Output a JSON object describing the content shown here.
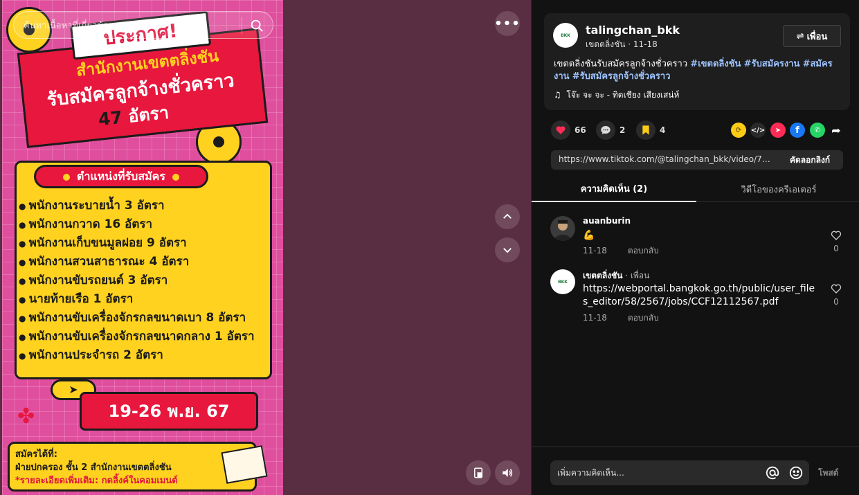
{
  "search": {
    "placeholder": "ค้นหาเนื้อหาที่เกี่ยวข้อง"
  },
  "poster": {
    "announce": "ประกาศ!",
    "line1": "สำนักงานเขตตลิ่งชัน",
    "line2": "รับสมัครลูกจ้างชั่วคราว",
    "count": "47",
    "count_unit": "อัตรา",
    "positions_header": "ตำแหน่งที่รับสมัคร",
    "positions": [
      "พนักงานระบายน้ำ 3 อัตรา",
      "พนักงานกวาด 16 อัตรา",
      "พนักงานเก็บขนมูลฝอย 9 อัตรา",
      "พนักงานสวนสาธารณะ 4 อัตรา",
      "พนักงานขับรถยนต์ 3 อัตรา",
      "นายท้ายเรือ 1 อัตรา",
      "พนักงานขับเครื่องจักรกลขนาดเบา 8 อัตรา",
      "พนักงานขับเครื่องจักรกลขนาดกลาง 1 อัตรา",
      "พนักงานประจำรถ 2 อัตรา"
    ],
    "date": "19-26 พ.ย. 67",
    "apply_title": "สมัครได้ที่:",
    "apply_place": "ฝ่ายปกครอง ชั้น 2 สำนักงานเขตตลิ่งชัน",
    "apply_note": "*รายละเอียดเพิ่มเติม: กดลิ้งค์ในคอมเมนต์"
  },
  "post": {
    "username": "talingchan_bkk",
    "subtitle": "เขตตลิ่งชัน · 11-18",
    "follow_label": "เพื่อน",
    "desc_text": "เขตตลิ่งชันรับสมัครลูกจ้างชั่วคราว ",
    "hashtags": [
      "#เขตตลิ่งชัน",
      "#รับสมัครงาน",
      "#สมัครงาน",
      "#รับสมัครลูกจ้างชั่วคราว"
    ],
    "music": "โจ๊ะ จะ จะ - ทิดเชียง เสียงเสน่ห์",
    "likes": "66",
    "comments": "2",
    "saves": "4",
    "link": "https://www.tiktok.com/@talingchan_bkk/video/7438...",
    "copy_label": "คัดลอกลิงก์"
  },
  "tabs": {
    "comments": "ความคิดเห็น (2)",
    "creator_videos": "วิดีโอของครีเอเตอร์"
  },
  "comments": [
    {
      "name": "auanburin",
      "badge": "",
      "text": "💪",
      "date": "11-18",
      "reply": "ตอบกลับ",
      "likes": "0"
    },
    {
      "name": "เขตตลิ่งชัน",
      "badge": " · เพื่อน",
      "text": "https://webportal.bangkok.go.th/public/user_files_editor/58/2567/jobs/CCF12112567.pdf",
      "date": "11-18",
      "reply": "ตอบกลับ",
      "likes": "0"
    }
  ],
  "compose": {
    "placeholder": "เพิ่มความคิดเห็น...",
    "post_label": "โพสต์"
  },
  "icons": {
    "share_targets": [
      "repost-icon",
      "embed-icon",
      "send-icon",
      "facebook-icon",
      "whatsapp-icon",
      "share-arrow-icon"
    ]
  },
  "colors": {
    "like": "#fe2c55",
    "save": "#facc15",
    "hashtag": "#9dc3ff",
    "poster_bg": "#e04f9e",
    "poster_red": "#e8173d",
    "poster_yellow": "#ffd21f"
  }
}
